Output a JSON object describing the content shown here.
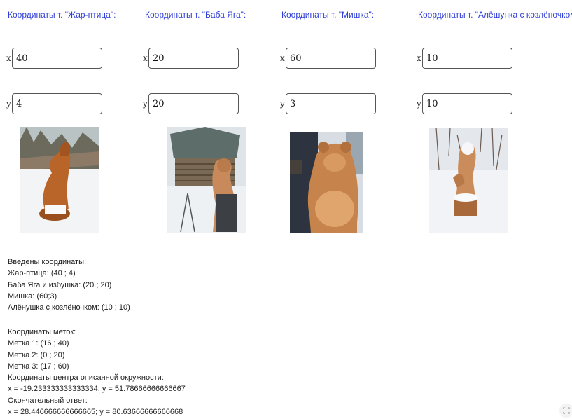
{
  "columns": [
    {
      "title": "Координаты т. \"Жар-птица\":",
      "x_label": "x",
      "x_value": "40",
      "y_label": "y",
      "y_value": "4",
      "photo": "firebird-wood-carving-photo"
    },
    {
      "title": "Координаты т. \"Баба Яга\":",
      "x_label": "x",
      "x_value": "20",
      "y_label": "y",
      "y_value": "20",
      "photo": "baba-yaga-hut-wood-carving-photo"
    },
    {
      "title": "Координаты т. \"Мишка\":",
      "x_label": "x",
      "x_value": "60",
      "y_label": "y",
      "y_value": "3",
      "photo": "bear-wood-carving-photo"
    },
    {
      "title": "Координаты т. \"Алёшунка с козлёночком\":",
      "x_label": "x",
      "x_value": "10",
      "y_label": "y",
      "y_value": "10",
      "photo": "alyonushka-wood-carving-photo"
    }
  ],
  "output": {
    "entered_heading": "Введены координаты:",
    "entered": [
      "Жар-птица: (40 ; 4)",
      "Баба Яга и избушка: (20 ; 20)",
      "Мишка: (60;3)",
      "Алёнушка с козлёночком: (10 ; 10)"
    ],
    "marks_heading": "Координаты меток:",
    "marks": [
      "Метка 1: (16 ; 40)",
      "Метка 2: (0 ; 20)",
      "Метка 3: (17 ; 60)"
    ],
    "center_heading": "Координаты центра описанной окружности:",
    "center_value": "x = -19.233333333333334; y = 51.78666666666667",
    "answer_heading": "Окончательный ответ:",
    "answer_value": "x = 28.446666666666665; y = 80.63666666666668"
  },
  "icons": {
    "resize": "fullscreen-icon"
  }
}
